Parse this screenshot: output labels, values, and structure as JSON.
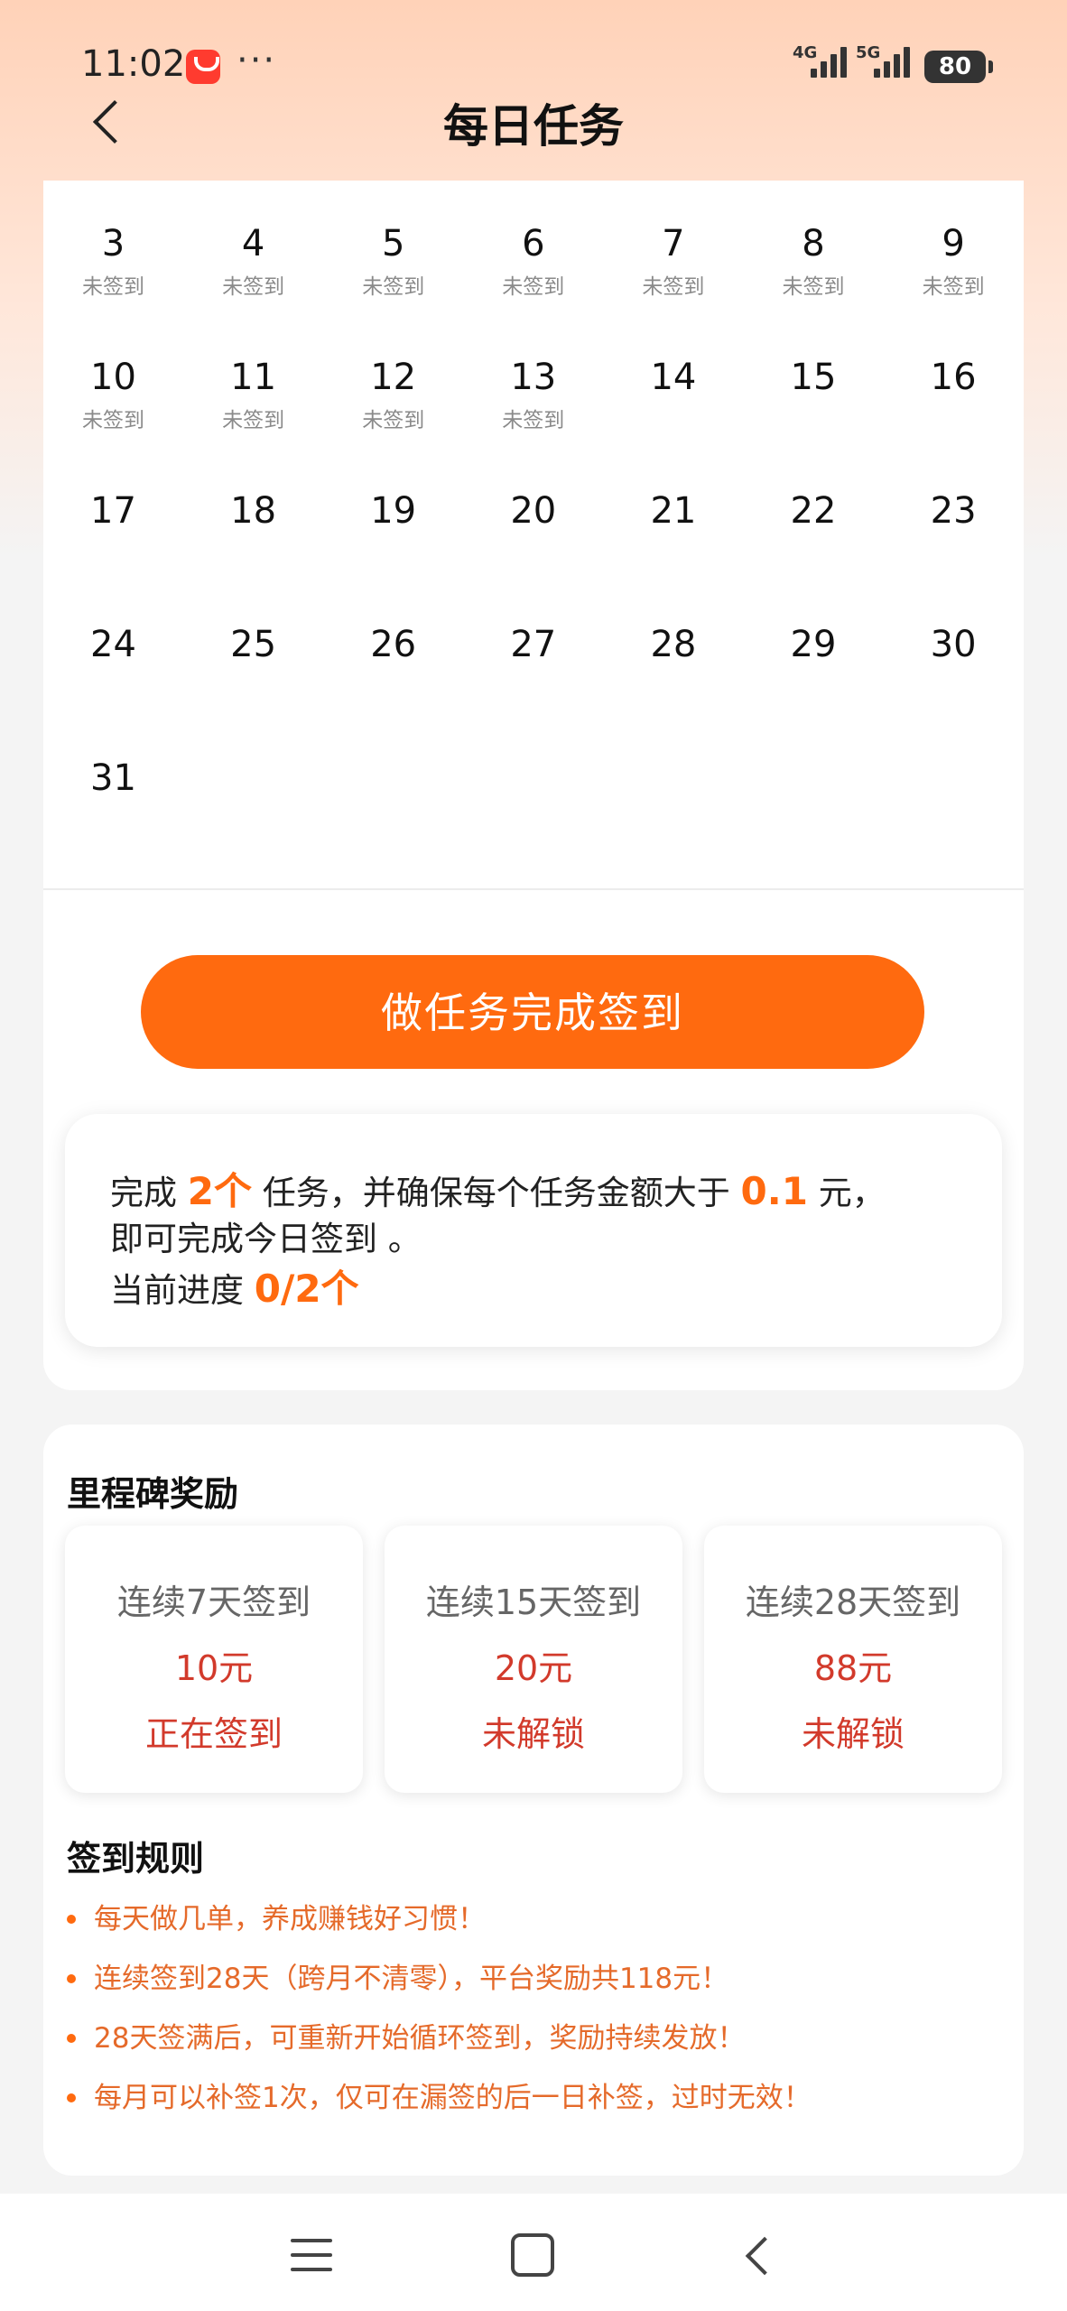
{
  "status_bar": {
    "time": "11:02",
    "dots": "···",
    "sig1_label": "4G",
    "sig2_label": "5G",
    "battery": "80"
  },
  "header": {
    "title": "每日任务"
  },
  "calendar": {
    "days": [
      {
        "day": "3",
        "status": "未签到"
      },
      {
        "day": "4",
        "status": "未签到"
      },
      {
        "day": "5",
        "status": "未签到"
      },
      {
        "day": "6",
        "status": "未签到"
      },
      {
        "day": "7",
        "status": "未签到"
      },
      {
        "day": "8",
        "status": "未签到"
      },
      {
        "day": "9",
        "status": "未签到"
      },
      {
        "day": "10",
        "status": "未签到"
      },
      {
        "day": "11",
        "status": "未签到"
      },
      {
        "day": "12",
        "status": "未签到"
      },
      {
        "day": "13",
        "status": "未签到"
      },
      {
        "day": "14",
        "status": ""
      },
      {
        "day": "15",
        "status": ""
      },
      {
        "day": "16",
        "status": ""
      },
      {
        "day": "17",
        "status": ""
      },
      {
        "day": "18",
        "status": ""
      },
      {
        "day": "19",
        "status": ""
      },
      {
        "day": "20",
        "status": ""
      },
      {
        "day": "21",
        "status": ""
      },
      {
        "day": "22",
        "status": ""
      },
      {
        "day": "23",
        "status": ""
      },
      {
        "day": "24",
        "status": ""
      },
      {
        "day": "25",
        "status": ""
      },
      {
        "day": "26",
        "status": ""
      },
      {
        "day": "27",
        "status": ""
      },
      {
        "day": "28",
        "status": ""
      },
      {
        "day": "29",
        "status": ""
      },
      {
        "day": "30",
        "status": ""
      },
      {
        "day": "31",
        "status": ""
      }
    ]
  },
  "cta_label": "做任务完成签到",
  "task": {
    "line1_prefix": "完成",
    "task_count": "2个",
    "line1_middle": "任务，并确保每个任务金额大于",
    "min_amount": "0.1",
    "line1_suffix": "元，",
    "line2": "即可完成今日签到 。",
    "progress_label": "当前进度",
    "progress_value": "0/2个"
  },
  "milestones": {
    "title": "里程碑奖励",
    "items": [
      {
        "title": "连续7天签到",
        "amount": "10元",
        "status": "正在签到"
      },
      {
        "title": "连续15天签到",
        "amount": "20元",
        "status": "未解锁"
      },
      {
        "title": "连续28天签到",
        "amount": "88元",
        "status": "未解锁"
      }
    ]
  },
  "rules": {
    "title": "签到规则",
    "items": [
      "每天做几单，养成赚钱好习惯！",
      "连续签到28天（跨月不清零），平台奖励共118元！",
      "28天签满后，可重新开始循环签到，奖励持续发放！",
      "每月可以补签1次，仅可在漏签的后一日补签，过时无效！"
    ]
  }
}
